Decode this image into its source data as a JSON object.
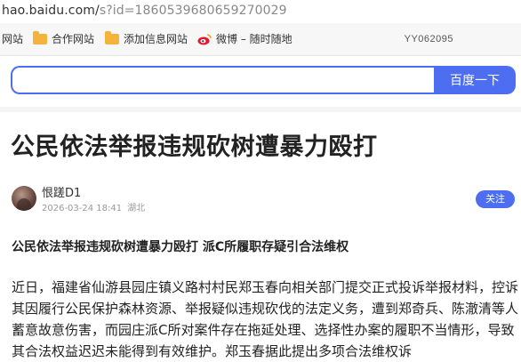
{
  "browser": {
    "url_host": "hao.baidu.com/",
    "url_path": "s?id=1860539680659270029"
  },
  "bookmarks": {
    "items": [
      {
        "label": "网站",
        "icon": "none"
      },
      {
        "label": "合作网站",
        "icon": "folder-icon"
      },
      {
        "label": "添加信息网站",
        "icon": "folder-icon"
      },
      {
        "label": "微博 – 随时随地",
        "icon": "weibo-icon"
      }
    ],
    "watermark": "YY062095"
  },
  "search": {
    "value": "",
    "button_label": "百度一下"
  },
  "article": {
    "title": "公民依法举报违规砍树遭暴力殴打",
    "author": "恨蹉D1",
    "date": "2026-03-24 18:41",
    "location": "湖北",
    "follow_label": "关注",
    "subtitle": "公民依法举报违规砍树遭暴力殴打 派C所履职存疑引合法维权",
    "paragraph": "近日，福建省仙游县园庄镇义路村村民郑玉春向相关部门提交正式投诉举报材料，控诉其因履行公民保护森林资源、举报疑似违规砍伐的法定义务，遭到郑奇兵、陈澈清等人蓄意故意伤害，而园庄派C所对案件存在拖延处理、选择性办案的履职不当情形，导致其合法权益迟迟未能得到有效维护。郑玉春据此提出多项合法维权诉"
  },
  "colors": {
    "accent": "#4e6ef2",
    "folder": "#f3b33d",
    "weibo": "#e6162d"
  }
}
